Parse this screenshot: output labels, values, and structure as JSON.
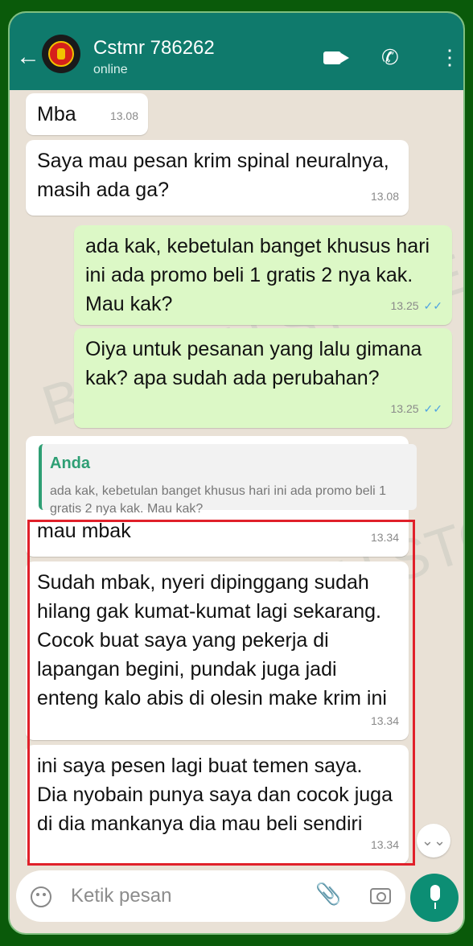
{
  "header": {
    "contact_name": "Cstmr 786262",
    "status": "online"
  },
  "messages": [
    {
      "side": "in",
      "text": "Mba",
      "time": "13.08"
    },
    {
      "side": "in",
      "text": "Saya mau pesan krim spinal neuralnya, masih ada ga?",
      "time": "13.08"
    },
    {
      "side": "out",
      "text": "ada kak, kebetulan banget khusus hari ini ada promo beli 1 gratis 2 nya kak. Mau kak?",
      "time": "13.25"
    },
    {
      "side": "out",
      "text": "Oiya untuk pesanan yang lalu gimana kak? apa sudah ada perubahan?",
      "time": "13.25"
    },
    {
      "side": "in",
      "text": "mau mbak",
      "time": "13.34",
      "quoted": {
        "name": "Anda",
        "text": "ada kak, kebetulan banget khusus hari ini ada promo beli 1 gratis 2 nya kak. Mau kak?"
      }
    },
    {
      "side": "in",
      "text": "Sudah mbak, nyeri dipinggang sudah hilang gak kumat-kumat lagi sekarang. Cocok buat saya yang pekerja di lapangan begini, pundak juga jadi enteng kalo abis di olesin make krim ini",
      "time": "13.34"
    },
    {
      "side": "in",
      "text": "ini saya pesen lagi buat temen saya. Dia nyobain punya saya dan cocok juga di dia mankanya dia mau beli sendiri",
      "time": "13.34"
    }
  ],
  "composer": {
    "placeholder": "Ketik pesan"
  },
  "watermark": "BERKAH STORE",
  "icons": [
    "back-arrow-icon",
    "avatar",
    "video-call-icon",
    "phone-icon",
    "more-options-icon",
    "emoji-icon",
    "attach-icon",
    "camera-icon",
    "mic-icon",
    "read-ticks-icon",
    "scroll-down-icon"
  ],
  "colors": {
    "header": "#0f7a6c",
    "outgoing_bubble": "#dcf8c6",
    "incoming_bubble": "#ffffff",
    "chat_background": "#e9e1d6",
    "highlight": "#e0202a",
    "mic_button": "#0c8e74"
  }
}
